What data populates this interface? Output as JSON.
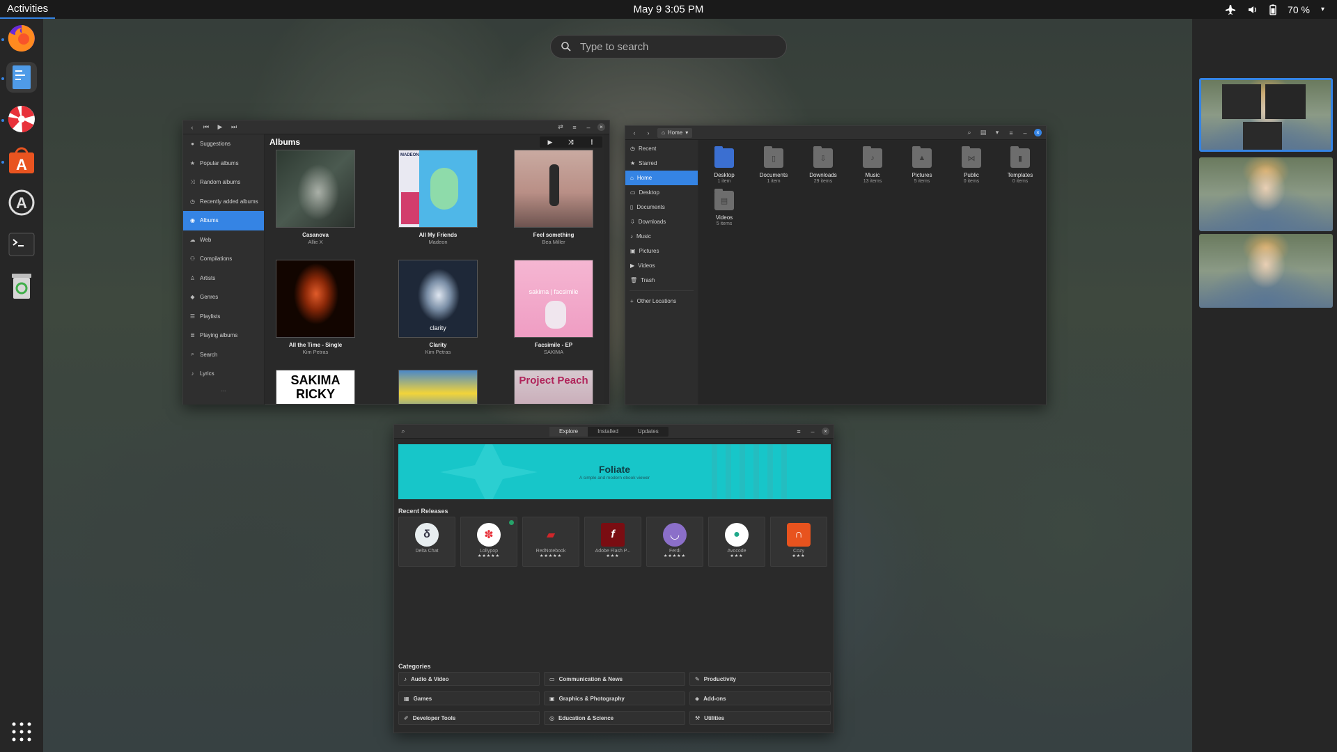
{
  "topbar": {
    "activities": "Activities",
    "clock": "May 9  3:05 PM",
    "battery": "70 %"
  },
  "search": {
    "placeholder": "Type to search"
  },
  "dash": {
    "apps": [
      "firefox-icon",
      "text-editor-icon",
      "lollypop-icon",
      "software-center-icon",
      "software-updater-icon",
      "terminal-icon",
      "trash-icon"
    ],
    "show_apps": "show-applications-icon"
  },
  "music": {
    "title": "Albums",
    "sidebar": [
      "Suggestions",
      "Popular albums",
      "Random albums",
      "Recently added albums",
      "Albums",
      "Web",
      "Compilations",
      "Artists",
      "Genres",
      "Playlists",
      "Playing albums",
      "Search",
      "Lyrics"
    ],
    "more": "...",
    "albums": [
      {
        "title": "Casanova",
        "artist": "Allie X"
      },
      {
        "title": "All My Friends",
        "artist": "Madeon"
      },
      {
        "title": "Feel something",
        "artist": "Bea Miller"
      },
      {
        "title": "All the Time - Single",
        "artist": "Kim Petras"
      },
      {
        "title": "Clarity",
        "artist": "Kim Petras"
      },
      {
        "title": "Facsimile - EP",
        "artist": "SAKIMA"
      }
    ],
    "partial_covers": [
      "SAKIMA RICKY",
      "",
      "Project Peach"
    ],
    "cover_texts": {
      "madeon": "MADEON",
      "facsimile": "sakima | facsimile",
      "clarity": "clarity"
    }
  },
  "files": {
    "path": "Home",
    "sidebar": [
      "Recent",
      "Starred",
      "Home",
      "Desktop",
      "Documents",
      "Downloads",
      "Music",
      "Pictures",
      "Videos",
      "Trash",
      "Other Locations"
    ],
    "folders": [
      {
        "name": "Desktop",
        "count": "1 item"
      },
      {
        "name": "Documents",
        "count": "1 item"
      },
      {
        "name": "Downloads",
        "count": "29 items"
      },
      {
        "name": "Music",
        "count": "13 items"
      },
      {
        "name": "Pictures",
        "count": "5 items"
      },
      {
        "name": "Public",
        "count": "0 items"
      },
      {
        "name": "Templates",
        "count": "0 items"
      },
      {
        "name": "Videos",
        "count": "5 items"
      }
    ]
  },
  "software": {
    "tabs": [
      "Explore",
      "Installed",
      "Updates"
    ],
    "banner": {
      "title": "Foliate",
      "subtitle": "A simple and modern ebook viewer"
    },
    "recent_label": "Recent Releases",
    "recent": [
      {
        "name": "Delta Chat",
        "stars": ""
      },
      {
        "name": "Lollypop",
        "stars": "★★★★★"
      },
      {
        "name": "RedNotebook",
        "stars": "★★★★★"
      },
      {
        "name": "Adobe Flash P...",
        "stars": "★★★"
      },
      {
        "name": "Ferdi",
        "stars": "★★★★★"
      },
      {
        "name": "Avocode",
        "stars": "★★★"
      },
      {
        "name": "Cozy",
        "stars": "★★★"
      }
    ],
    "categories_label": "Categories",
    "categories": [
      "Audio & Video",
      "Communication & News",
      "Productivity",
      "Games",
      "Graphics & Photography",
      "Add-ons",
      "Developer Tools",
      "Education & Science",
      "Utilities"
    ]
  }
}
